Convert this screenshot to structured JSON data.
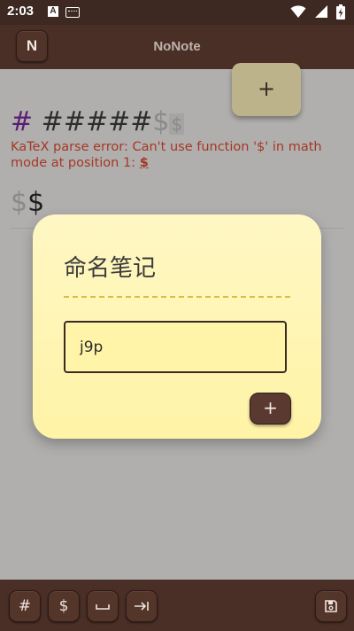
{
  "status_bar": {
    "time": "2:03",
    "notification_letter": "A"
  },
  "app_bar": {
    "logo_letter": "N",
    "title": "NoNote"
  },
  "fab": {
    "label": "+"
  },
  "editor": {
    "heading_hash": "#",
    "heading_text": " #####",
    "heading_dollar": "$",
    "heading_dollar_small": "$",
    "katex_error_prefix": "KaTeX parse error: Can't use function '$' in math mode at position 1: ",
    "katex_error_symbol": "$",
    "math_dollar_1": "$",
    "math_dollar_2": "$"
  },
  "dialog": {
    "title": "命名笔记",
    "input_value": "j9p",
    "add_label": "+"
  },
  "toolbar": {
    "hash_label": "#",
    "dollar_label": "$"
  },
  "colors": {
    "app_bar": "#4a2f26",
    "dialog_bg": "#fff5b0",
    "accent_dash": "#e1b94a",
    "error_text": "#a53824"
  }
}
